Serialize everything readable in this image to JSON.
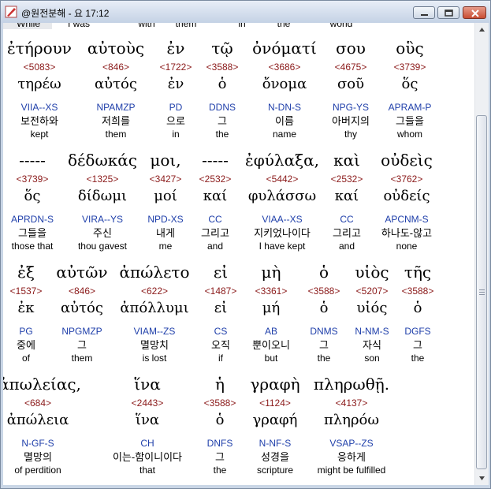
{
  "window": {
    "title": "@원전분해 - 요 17:12"
  },
  "partial_top": [
    "While",
    "I was",
    "with",
    "them",
    "in",
    "the",
    "world"
  ],
  "rows": [
    [
      {
        "greek": "ἐτήρουν",
        "strongs": "<5083>",
        "lemma": "τηρέω",
        "parsing": "VIIA--XS",
        "korean": "보전하와",
        "english": "kept"
      },
      {
        "greek": "αὐτοὺς",
        "strongs": "<846>",
        "lemma": "αὐτός",
        "parsing": "NPAMZP",
        "korean": "저희를",
        "english": "them"
      },
      {
        "greek": "ἐν",
        "strongs": "<1722>",
        "lemma": "ἐν",
        "parsing": "PD",
        "korean": "으로",
        "english": "in"
      },
      {
        "greek": "τῷ",
        "strongs": "<3588>",
        "lemma": "ὁ",
        "parsing": "DDNS",
        "korean": "그",
        "english": "the"
      },
      {
        "greek": "ὀνόματί",
        "strongs": "<3686>",
        "lemma": "ὄνομα",
        "parsing": "N-DN-S",
        "korean": "이름",
        "english": "name"
      },
      {
        "greek": "σου",
        "strongs": "<4675>",
        "lemma": "σοῦ",
        "parsing": "NPG-YS",
        "korean": "아버지의",
        "english": "thy"
      },
      {
        "greek": "οὓς",
        "strongs": "<3739>",
        "lemma": "ὅς",
        "parsing": "APRAM-P",
        "korean": "그들을",
        "english": "whom"
      }
    ],
    [
      {
        "greek": "-----",
        "strongs": "<3739>",
        "lemma": "ὅς",
        "parsing": "APRDN-S",
        "korean": "그들을",
        "english": "those that"
      },
      {
        "greek": "δέδωκάς",
        "strongs": "<1325>",
        "lemma": "δίδωμι",
        "parsing": "VIRA--YS",
        "korean": "주신",
        "english": "thou gavest"
      },
      {
        "greek": "μοι,",
        "strongs": "<3427>",
        "lemma": "μοί",
        "parsing": "NPD-XS",
        "korean": "내게",
        "english": "me"
      },
      {
        "greek": "-----",
        "strongs": "<2532>",
        "lemma": "καί",
        "parsing": "CC",
        "korean": "그리고",
        "english": "and"
      },
      {
        "greek": "ἐφύλαξα,",
        "strongs": "<5442>",
        "lemma": "φυλάσσω",
        "parsing": "VIAA--XS",
        "korean": "지키었나이다",
        "english": "I have kept"
      },
      {
        "greek": "καὶ",
        "strongs": "<2532>",
        "lemma": "καί",
        "parsing": "CC",
        "korean": "그리고",
        "english": "and"
      },
      {
        "greek": "οὐδεὶς",
        "strongs": "<3762>",
        "lemma": "οὐδείς",
        "parsing": "APCNM-S",
        "korean": "하나도-않고",
        "english": "none"
      }
    ],
    [
      {
        "greek": "ἐξ",
        "strongs": "<1537>",
        "lemma": "ἐκ",
        "parsing": "PG",
        "korean": "중에",
        "english": "of"
      },
      {
        "greek": "αὐτῶν",
        "strongs": "<846>",
        "lemma": "αὐτός",
        "parsing": "NPGMZP",
        "korean": "그",
        "english": "them"
      },
      {
        "greek": "ἀπώλετο",
        "strongs": "<622>",
        "lemma": "ἀπόλλυμι",
        "parsing": "VIAM--ZS",
        "korean": "멸망치",
        "english": "is lost"
      },
      {
        "greek": "εἰ",
        "strongs": "<1487>",
        "lemma": "εἰ",
        "parsing": "CS",
        "korean": "오직",
        "english": "if"
      },
      {
        "greek": "μὴ",
        "strongs": "<3361>",
        "lemma": "μή",
        "parsing": "AB",
        "korean": "뿐이오니",
        "english": "but"
      },
      {
        "greek": "ὁ",
        "strongs": "<3588>",
        "lemma": "ὁ",
        "parsing": "DNMS",
        "korean": "그",
        "english": "the"
      },
      {
        "greek": "υἱὸς",
        "strongs": "<5207>",
        "lemma": "υἱός",
        "parsing": "N-NM-S",
        "korean": "자식",
        "english": "son"
      },
      {
        "greek": "τῆς",
        "strongs": "<3588>",
        "lemma": "ὁ",
        "parsing": "DGFS",
        "korean": "그",
        "english": "the"
      }
    ],
    [
      {
        "greek": "ἀπωλείας,",
        "strongs": "<684>",
        "lemma": "ἀπώλεια",
        "parsing": "N-GF-S",
        "korean": "멸망의",
        "english": "of perdition"
      },
      {
        "greek": "ἵνα",
        "strongs": "<2443>",
        "lemma": "ἵνα",
        "parsing": "CH",
        "korean": "이는-함이니이다",
        "english": "that"
      },
      {
        "greek": "ἡ",
        "strongs": "<3588>",
        "lemma": "ὁ",
        "parsing": "DNFS",
        "korean": "그",
        "english": "the"
      },
      {
        "greek": "γραφὴ",
        "strongs": "<1124>",
        "lemma": "γραφή",
        "parsing": "N-NF-S",
        "korean": "성경을",
        "english": "scripture"
      },
      {
        "greek": "πληρωθῇ.",
        "strongs": "<4137>",
        "lemma": "πληρόω",
        "parsing": "VSAP--ZS",
        "korean": "응하게",
        "english": "might be fulfilled"
      }
    ]
  ]
}
